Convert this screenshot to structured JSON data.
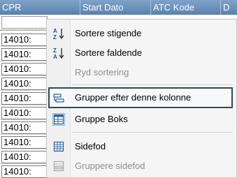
{
  "grid": {
    "columns": [
      "CPR",
      "Start Dato",
      "ATC Kode",
      "D"
    ],
    "rows": [
      "14010:",
      "14010:",
      "14010:",
      "14010:",
      "14010:",
      "14010:",
      "14010:",
      "14010:"
    ]
  },
  "menu": {
    "items": [
      {
        "label": "Sortere stigende",
        "icon": "sort-ascending-icon",
        "enabled": true
      },
      {
        "label": "Sortere faldende",
        "icon": "sort-descending-icon",
        "enabled": true
      },
      {
        "label": "Ryd sortering",
        "icon": "",
        "enabled": false
      },
      {
        "label": "Grupper efter denne kolonne",
        "icon": "group-by-column-icon",
        "enabled": true
      },
      {
        "label": "Gruppe Boks",
        "icon": "group-box-icon",
        "enabled": true
      },
      {
        "label": "Sidefod",
        "icon": "footer-icon",
        "enabled": true
      },
      {
        "label": "Gruppere sidefod",
        "icon": "group-footer-icon",
        "enabled": false
      }
    ]
  },
  "colors": {
    "header": "#6b90bb",
    "highlight_border": "#2f4a5c",
    "disabled_text": "#8f8f8f"
  }
}
